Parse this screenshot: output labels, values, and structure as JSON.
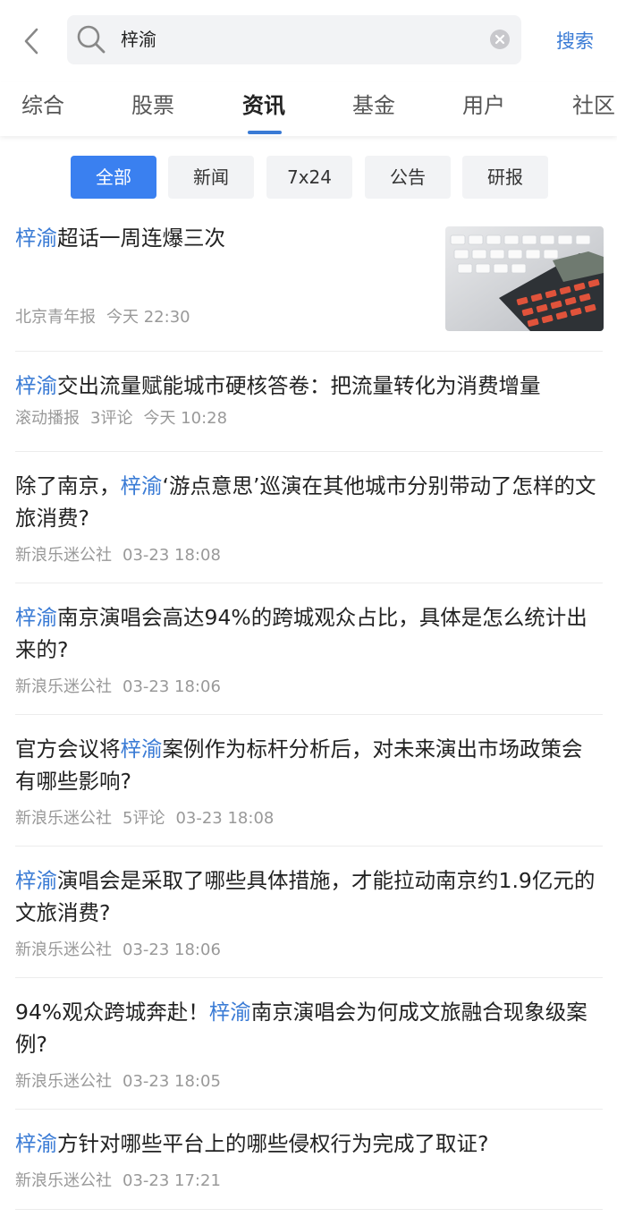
{
  "search": {
    "query": "梓渝",
    "button_label": "搜索"
  },
  "tabs": [
    {
      "label": "综合"
    },
    {
      "label": "股票"
    },
    {
      "label": "资讯"
    },
    {
      "label": "基金"
    },
    {
      "label": "用户"
    },
    {
      "label": "社区"
    }
  ],
  "active_tab": "资讯",
  "filters": [
    {
      "label": "全部"
    },
    {
      "label": "新闻"
    },
    {
      "label": "7x24"
    },
    {
      "label": "公告"
    },
    {
      "label": "研报"
    }
  ],
  "active_filter": "全部",
  "colors": {
    "accent": "#3a7bd5",
    "chip_active": "#3a80f0",
    "meta_text": "#999999"
  },
  "articles": [
    {
      "pre": "",
      "hl": "梓渝",
      "post": "超话一周连爆三次",
      "source": "北京青年报",
      "comments": "",
      "time": "今天 22:30",
      "has_image": true
    },
    {
      "pre": "",
      "hl": "梓渝",
      "post": "交出流量赋能城市硬核答卷：把流量转化为消费增量",
      "source": "滚动播报",
      "comments": "3评论",
      "time": "今天 10:28"
    },
    {
      "pre": "除了南京，",
      "hl": "梓渝",
      "post": "‘游点意思’巡演在其他城市分别带动了怎样的文旅消费?",
      "source": "新浪乐迷公社",
      "comments": "",
      "time": "03-23 18:08"
    },
    {
      "pre": "",
      "hl": "梓渝",
      "post": "南京演唱会高达94%的跨城观众占比，具体是怎么统计出来的?",
      "source": "新浪乐迷公社",
      "comments": "",
      "time": "03-23 18:06"
    },
    {
      "pre": "官方会议将",
      "hl": "梓渝",
      "post": "案例作为标杆分析后，对未来演出市场政策会有哪些影响?",
      "source": "新浪乐迷公社",
      "comments": "5评论",
      "time": "03-23 18:08"
    },
    {
      "pre": "",
      "hl": "梓渝",
      "post": "演唱会是采取了哪些具体措施，才能拉动南京约1.9亿元的文旅消费?",
      "source": "新浪乐迷公社",
      "comments": "",
      "time": "03-23 18:06"
    },
    {
      "pre": "94%观众跨城奔赴！",
      "hl": "梓渝",
      "post": "南京演唱会为何成文旅融合现象级案例?",
      "source": "新浪乐迷公社",
      "comments": "",
      "time": "03-23 18:05"
    },
    {
      "pre": "",
      "hl": "梓渝",
      "post": "方针对哪些平台上的哪些侵权行为完成了取证?",
      "source": "新浪乐迷公社",
      "comments": "",
      "time": "03-23 17:21"
    }
  ]
}
